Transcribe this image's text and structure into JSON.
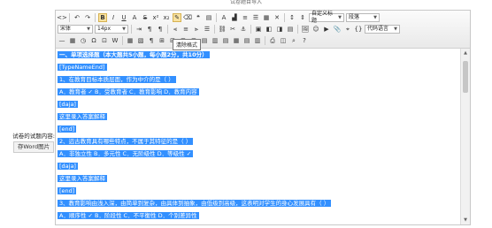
{
  "page": {
    "top_title": "试卷题目导入"
  },
  "left": {
    "label": "试卷的试题内容:",
    "button": "存Word图片"
  },
  "toolbar": {
    "font_family": "宋体",
    "font_size": "14px",
    "custom_title": "自定义标题",
    "paragraph": "段落",
    "code_lang": "代码语言",
    "tooltip": "清除格式"
  },
  "content": {
    "lines": [
      {
        "text": "一、单项选择题（本大题共5小题，每小题2分，共10分）",
        "bold": true
      },
      {
        "text": "[TypeNameEnd]"
      },
      {
        "text": "1、在教育目标本质层面，作为中介的是（    ）"
      },
      {
        "text": "A．教育者 ✓    B．受教育者      C．教育影响      D．教育内容"
      },
      {
        "text": "[daja]"
      },
      {
        "text": "这里录入答案解释"
      },
      {
        "text": "[end]"
      },
      {
        "text": "2、远古教育具有哪些特点，不属于其特征的是（    ）"
      },
      {
        "text": "A．非独立性    B．多元性        C．无阶级性      D．等级性 ✓"
      },
      {
        "text": "[daja]"
      },
      {
        "text": "这里录入答案解释"
      },
      {
        "text": "[end]"
      },
      {
        "text": "3、教育影响由浅入深，由简单到复杂，由具体到抽象，由低级到高级，这表明对学生的身心发展具有（    ）"
      },
      {
        "text": "A．顺序性 ✓    B．阶段性        C．不平衡性      D．个别差异性"
      }
    ]
  }
}
